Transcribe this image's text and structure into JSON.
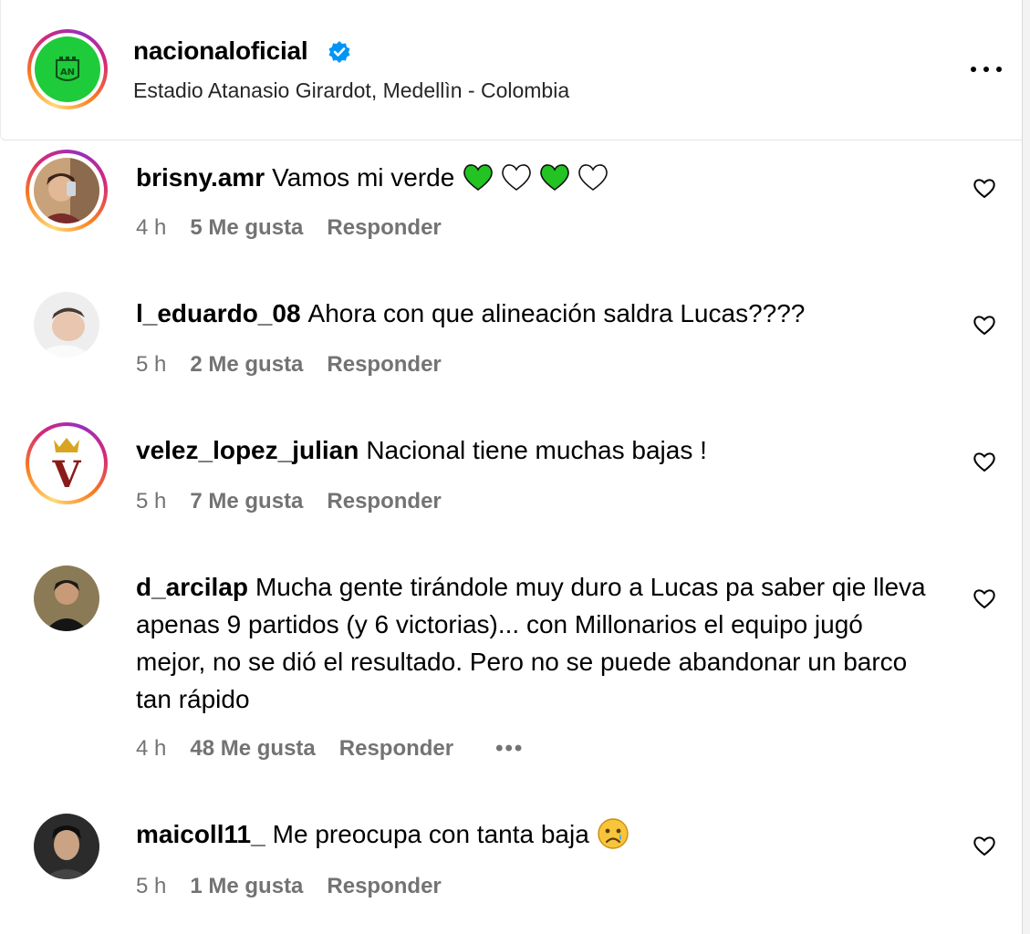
{
  "post": {
    "username": "nacionaloficial",
    "location": "Estadio Atanasio Girardot, Medellìn - Colombia",
    "verified": true
  },
  "colors": {
    "club_green": "#1ecb3a",
    "verified_blue": "#0095f6",
    "meta_gray": "#737373"
  },
  "comments": [
    {
      "username": "brisny.amr",
      "text": "Vamos mi verde",
      "emoji": [
        "green-heart",
        "white-heart",
        "green-heart",
        "white-heart"
      ],
      "time": "4 h",
      "likes": "5 Me gusta",
      "reply": "Responder",
      "story_ring": true
    },
    {
      "username": "l_eduardo_08",
      "text": "Ahora con que alineación saldra Lucas????",
      "time": "5 h",
      "likes": "2 Me gusta",
      "reply": "Responder",
      "story_ring": false
    },
    {
      "username": "velez_lopez_julian",
      "text": "Nacional tiene muchas bajas !",
      "time": "5 h",
      "likes": "7 Me gusta",
      "reply": "Responder",
      "story_ring": true
    },
    {
      "username": "d_arcilap",
      "text": "Mucha gente tirándole muy duro a Lucas pa saber qie lleva apenas 9 partidos (y 6 victorias)... con Millonarios el equipo jugó mejor, no se dió el resultado. Pero no se puede abandonar un barco tan rápido",
      "time": "4 h",
      "likes": "48 Me gusta",
      "reply": "Responder",
      "more": "•••",
      "story_ring": false
    },
    {
      "username": "maicoll11_",
      "text": "Me preocupa con tanta baja",
      "emoji": [
        "sad-face"
      ],
      "time": "5 h",
      "likes": "1 Me gusta",
      "reply": "Responder",
      "story_ring": false
    }
  ]
}
